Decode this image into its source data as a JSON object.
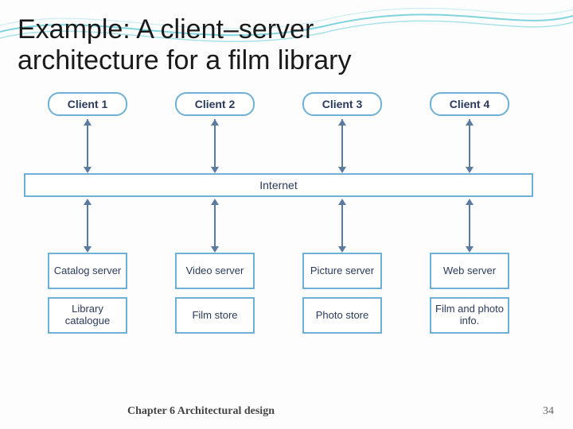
{
  "title_line1": "Example: A client–server",
  "title_line2": "architecture for a film library",
  "clients": [
    "Client 1",
    "Client 2",
    "Client 3",
    "Client 4"
  ],
  "internet": "Internet",
  "servers": [
    "Catalog server",
    "Video server",
    "Picture server",
    "Web server"
  ],
  "stores": [
    "Library catalogue",
    "Film store",
    "Photo store",
    "Film and photo info."
  ],
  "footer_chapter": "Chapter 6 Architectural design",
  "footer_page": "34",
  "colors": {
    "border": "#6fb1d6",
    "text": "#2a3a5a",
    "line": "#5a7ba0"
  },
  "chart_data": {
    "type": "diagram",
    "title": "A client–server architecture for a film library",
    "nodes": [
      {
        "id": "c1",
        "label": "Client 1",
        "kind": "client"
      },
      {
        "id": "c2",
        "label": "Client 2",
        "kind": "client"
      },
      {
        "id": "c3",
        "label": "Client 3",
        "kind": "client"
      },
      {
        "id": "c4",
        "label": "Client 4",
        "kind": "client"
      },
      {
        "id": "net",
        "label": "Internet",
        "kind": "bus"
      },
      {
        "id": "s1",
        "label": "Catalog server",
        "kind": "server"
      },
      {
        "id": "s2",
        "label": "Video server",
        "kind": "server"
      },
      {
        "id": "s3",
        "label": "Picture server",
        "kind": "server"
      },
      {
        "id": "s4",
        "label": "Web server",
        "kind": "server"
      },
      {
        "id": "d1",
        "label": "Library catalogue",
        "kind": "datastore"
      },
      {
        "id": "d2",
        "label": "Film store",
        "kind": "datastore"
      },
      {
        "id": "d3",
        "label": "Photo store",
        "kind": "datastore"
      },
      {
        "id": "d4",
        "label": "Film and photo info.",
        "kind": "datastore"
      }
    ],
    "edges": [
      {
        "from": "c1",
        "to": "net",
        "bidir": true
      },
      {
        "from": "c2",
        "to": "net",
        "bidir": true
      },
      {
        "from": "c3",
        "to": "net",
        "bidir": true
      },
      {
        "from": "c4",
        "to": "net",
        "bidir": true
      },
      {
        "from": "net",
        "to": "s1",
        "bidir": true
      },
      {
        "from": "net",
        "to": "s2",
        "bidir": true
      },
      {
        "from": "net",
        "to": "s3",
        "bidir": true
      },
      {
        "from": "net",
        "to": "s4",
        "bidir": true
      },
      {
        "from": "s1",
        "to": "d1",
        "bidir": false
      },
      {
        "from": "s2",
        "to": "d2",
        "bidir": false
      },
      {
        "from": "s3",
        "to": "d3",
        "bidir": false
      },
      {
        "from": "s4",
        "to": "d4",
        "bidir": false
      }
    ]
  }
}
